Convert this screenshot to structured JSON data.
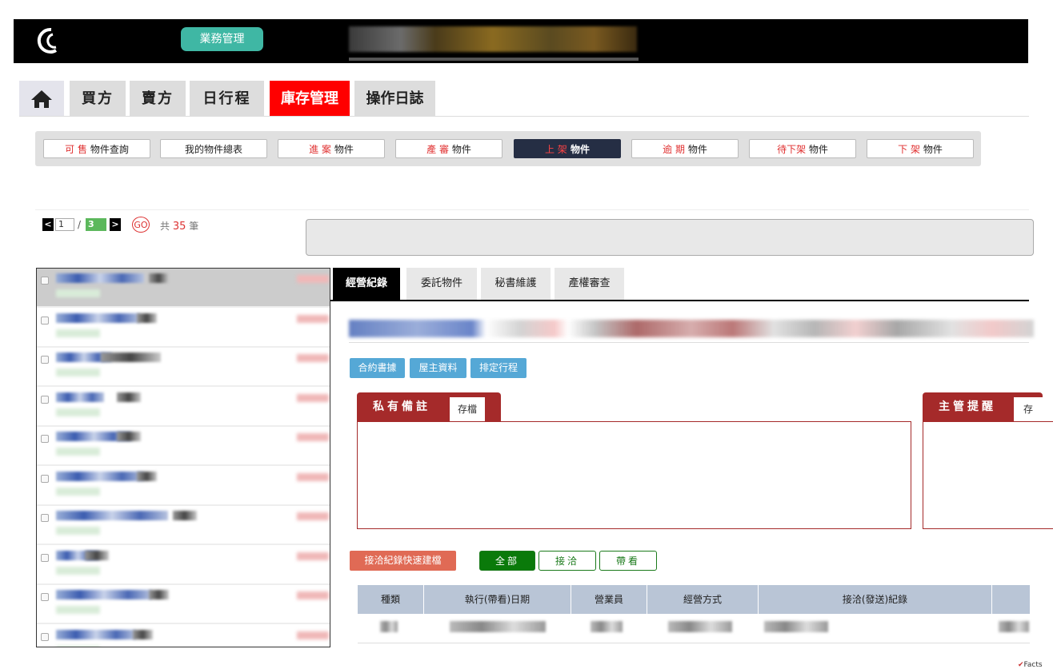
{
  "header": {
    "biz_button": "業務管理"
  },
  "main_tabs": [
    "買方",
    "賣方",
    "日行程",
    "庫存管理",
    "操作日誌"
  ],
  "subnav": [
    {
      "hl": "可 售",
      "rest": " 物件查詢",
      "active": false
    },
    {
      "hl": "",
      "rest": "我的物件總表",
      "active": false
    },
    {
      "hl": "進 案",
      "rest": " 物件",
      "active": false
    },
    {
      "hl": "產 審",
      "rest": " 物件",
      "active": false
    },
    {
      "hl": "上 架",
      "rest": " 物件",
      "active": true
    },
    {
      "hl": "逾 期",
      "rest": " 物件",
      "active": false
    },
    {
      "hl": "待下架",
      "rest": " 物件",
      "active": false
    },
    {
      "hl": "下 架",
      "rest": " 物件",
      "active": false
    }
  ],
  "pager": {
    "prev": "<",
    "current": "1",
    "slash": "/",
    "total_pages": "3",
    "next": ">",
    "go": "GO",
    "count_prefix": "共",
    "count": "35",
    "count_suffix": "筆"
  },
  "detail_tabs": [
    "經營紀錄",
    "委託物件",
    "秘書維護",
    "產權審查"
  ],
  "action_buttons": [
    "合約書據",
    "屋主資料",
    "排定行程"
  ],
  "private_note": {
    "label": "私有備註",
    "save": "存檔"
  },
  "manager_note": {
    "label": "主管提醒",
    "save": "存"
  },
  "quick_button": "接洽紀錄快速建檔",
  "filters": [
    "全部",
    "接洽",
    "帶看"
  ],
  "table_headers": [
    "種類",
    "執行(帶看)日期",
    "營業員",
    "經營方式",
    "接洽(發送)紀錄",
    ""
  ],
  "corner_text": "Facts"
}
